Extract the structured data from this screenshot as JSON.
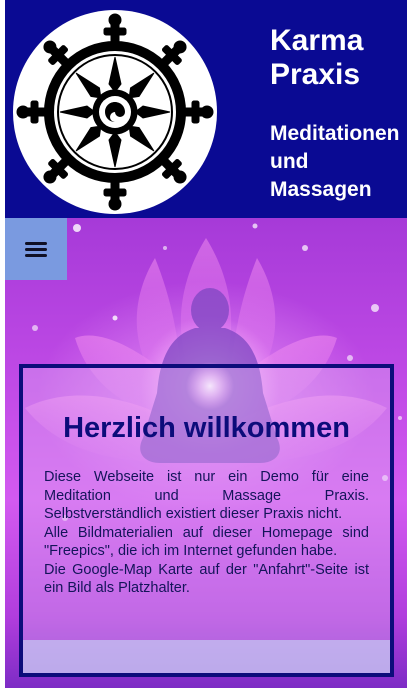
{
  "header": {
    "logo_icon": "dharma-wheel-icon",
    "title_line1": "Karma",
    "title_line2": "Praxis",
    "subtitle_line1": "Meditationen",
    "subtitle_line2": "und",
    "subtitle_line3": "Massagen",
    "background_color": "#0a0a93"
  },
  "nav": {
    "menu_icon": "hamburger-menu-icon"
  },
  "hero": {
    "image": "meditating-person-lotus-background",
    "welcome_title": "Herzlich willkommen",
    "paragraphs": [
      "Diese Webseite ist nur ein Demo für eine Meditation und Massage Praxis. Selbstverständlich existiert dieser Praxis nicht.",
      "Alle Bildmaterialien auf dieser Homepage sind \"Freepics\", die ich im Internet gefunden habe.",
      "Die Google-Map Karte auf der \"Anfahrt\"-Seite ist ein Bild als Platzhalter."
    ],
    "accent_color": "#0c0c7a"
  }
}
